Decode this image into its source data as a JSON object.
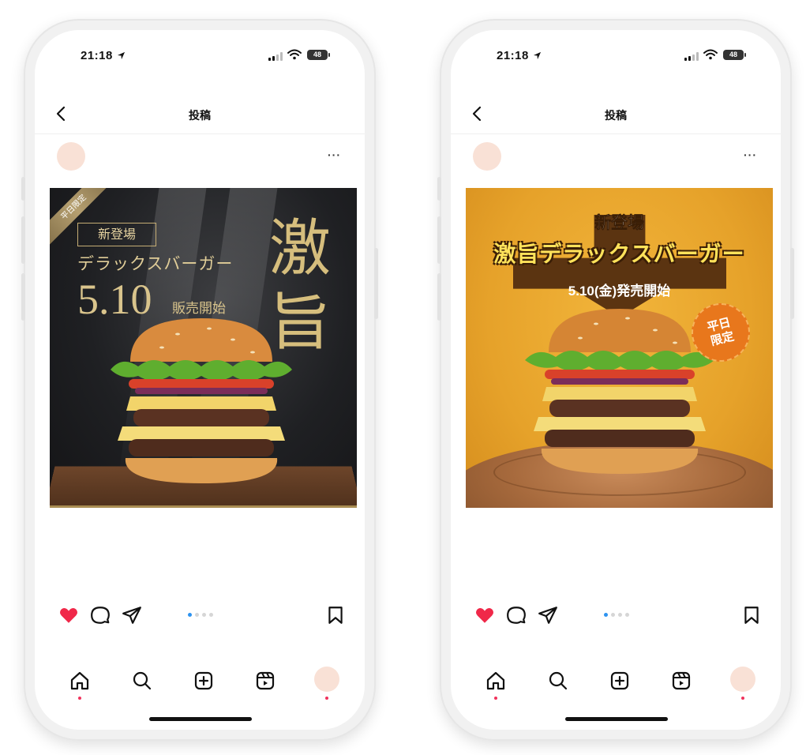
{
  "status_bar": {
    "time": "21:18",
    "battery": "48"
  },
  "post_screen": {
    "title": "投稿",
    "more": "···"
  },
  "left_poster": {
    "corner_ribbon": "平日限定",
    "badge": "新登場",
    "product": "デラックスバーガー",
    "date": "5.10",
    "sale": "販売開始",
    "headline": "激旨"
  },
  "right_poster": {
    "line1": "新登場",
    "line2": "激旨デラックスバーガー",
    "line3": "5.10(金)発売開始",
    "stamp": "平日\n限定"
  },
  "carousel": {
    "total": 4,
    "active_index": 0
  },
  "icons": {
    "back": "chevron-left-icon",
    "like": "heart-filled-icon",
    "comment": "comment-bubble-icon",
    "share": "send-paper-plane-icon",
    "save": "bookmark-icon",
    "home": "home-icon",
    "search": "search-icon",
    "create": "plus-square-icon",
    "reels": "reels-icon",
    "profile": "profile-avatar"
  },
  "colors": {
    "like_red": "#f02849",
    "active_dot": "#2d93f0",
    "notify_dot": "#f0325c",
    "avatar_placeholder": "#f9e1d6",
    "left_poster_bg": "#1f2023",
    "left_poster_gold": "#d6be7d",
    "right_poster_bg": "#e6a22a",
    "right_poster_brown": "#5b3411",
    "right_poster_yellow": "#ffe25a"
  }
}
